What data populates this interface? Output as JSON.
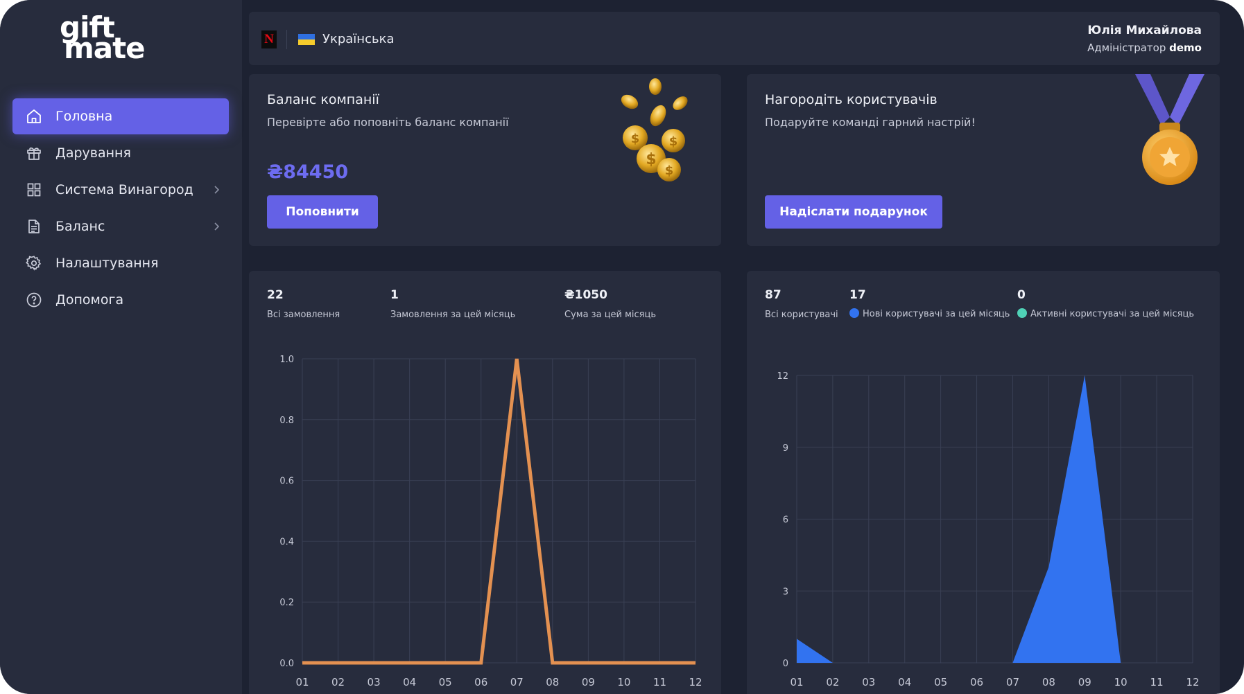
{
  "logo": {
    "line1": "gift",
    "line2": "mate"
  },
  "sidebar": {
    "items": [
      {
        "label": "Головна",
        "icon": "home-icon",
        "active": true,
        "has_chevron": false
      },
      {
        "label": "Дарування",
        "icon": "gift-icon",
        "active": false,
        "has_chevron": false
      },
      {
        "label": "Система Винагород",
        "icon": "grid-icon",
        "active": false,
        "has_chevron": true
      },
      {
        "label": "Баланс",
        "icon": "document-icon",
        "active": false,
        "has_chevron": true
      },
      {
        "label": "Налаштування",
        "icon": "gear-icon",
        "active": false,
        "has_chevron": false
      },
      {
        "label": "Допомога",
        "icon": "help-icon",
        "active": false,
        "has_chevron": false
      }
    ]
  },
  "topbar": {
    "app_icon_letter": "N",
    "language": "Українська",
    "user_name": "Юлія Михайлова",
    "user_role": "Адміністратор",
    "user_login": "demo"
  },
  "balance_card": {
    "title": "Баланс компанії",
    "subtitle": "Перевірте або поповніть баланс компанії",
    "amount": "₴84450",
    "button_label": "Поповнити",
    "icon": "coins-icon"
  },
  "reward_card": {
    "title": "Нагородіть користувачів",
    "subtitle": "Подаруйте команді гарний настрій!",
    "button_label": "Надіслати подарунок",
    "icon": "medal-icon"
  },
  "orders_panel": {
    "stats": [
      {
        "value": "22",
        "label": "Всі замовлення"
      },
      {
        "value": "1",
        "label": "Замовлення за цей місяць"
      },
      {
        "value": "₴1050",
        "label": "Сума за цей місяць"
      }
    ]
  },
  "users_panel": {
    "stats": [
      {
        "value": "87",
        "label": "Всі користувачі"
      },
      {
        "value": "17",
        "label": "Нові користувачі за цей місяць"
      },
      {
        "value": "0",
        "label": "Активні користувачі за цей місяць"
      }
    ]
  },
  "colors": {
    "accent": "#6461e6",
    "orders_line": "#e49151",
    "new_users": "#3273f0",
    "active_users": "#4fd1b6",
    "card_bg": "#272c3d",
    "page_bg": "#1d2232"
  },
  "chart_data": [
    {
      "type": "line",
      "x": [
        "01",
        "02",
        "03",
        "04",
        "05",
        "06",
        "07",
        "08",
        "09",
        "10",
        "11",
        "12"
      ],
      "series": [
        {
          "values": [
            0,
            0,
            0,
            0,
            0,
            0,
            1,
            0,
            0,
            0,
            0,
            0
          ]
        }
      ],
      "yticks": [
        "0.0",
        "0.2",
        "0.4",
        "0.6",
        "0.8",
        "1.0"
      ],
      "ylim": [
        0,
        1
      ],
      "grid": true
    },
    {
      "type": "area",
      "x": [
        "01",
        "02",
        "03",
        "04",
        "05",
        "06",
        "07",
        "08",
        "09",
        "10",
        "11",
        "12"
      ],
      "series": [
        {
          "name": "Нові користувачі за цей місяць",
          "values": [
            1,
            0,
            0,
            0,
            0,
            0,
            0,
            4,
            12,
            0,
            0,
            0
          ]
        }
      ],
      "yticks": [
        "0",
        "3",
        "6",
        "9",
        "12"
      ],
      "ylim": [
        0,
        12
      ],
      "grid": true
    }
  ]
}
